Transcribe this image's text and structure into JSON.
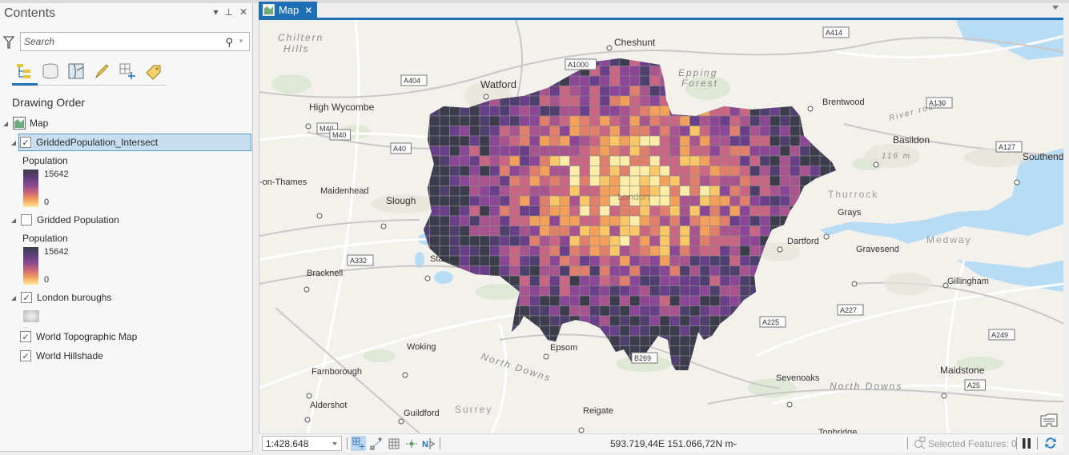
{
  "contents_pane": {
    "title": "Contents",
    "controls": {
      "menu": "▾",
      "pin": "⊥",
      "close": "✕"
    },
    "search": {
      "placeholder": "Search",
      "value": ""
    },
    "view_tabs": [
      "list-by-drawing-order",
      "list-by-source",
      "list-by-selection",
      "list-by-editing",
      "list-by-snapping",
      "list-by-labeling"
    ],
    "section_title": "Drawing Order",
    "map_item": {
      "label": "Map"
    },
    "layers": [
      {
        "label": "GriddedPopulation_Intersect",
        "checked": true,
        "selected": true,
        "legend": {
          "field": "Population",
          "max": "15642",
          "min": "0"
        }
      },
      {
        "label": "Gridded Population",
        "checked": false,
        "selected": false,
        "legend": {
          "field": "Population",
          "max": "15642",
          "min": "0"
        }
      },
      {
        "label": "London buroughs",
        "checked": true,
        "selected": false
      },
      {
        "label": "World Topographic Map",
        "checked": true,
        "selected": false
      },
      {
        "label": "World Hillshade",
        "checked": true,
        "selected": false
      }
    ]
  },
  "map_tab": {
    "label": "Map",
    "close": "✕"
  },
  "map": {
    "places": {
      "watford": "Watford",
      "cheshunt": "Cheshunt",
      "high_wycombe": "High Wycombe",
      "brentwood": "Brentwood",
      "basildon": "Basildon",
      "southend": "Southend",
      "slough": "Slough",
      "maidenhead": "Maidenhead",
      "on_thames": "-on-Thames",
      "grays": "Grays",
      "dartford": "Dartford",
      "gravesend": "Gravesend",
      "staines": "Staines",
      "bracknell": "Bracknell",
      "gillingham": "Gillingham",
      "epsom": "Epsom",
      "woking": "Woking",
      "farnborough": "Farnborough",
      "aldershot": "Aldershot",
      "guildford": "Guildford",
      "reigate": "Reigate",
      "sevenoaks": "Sevenoaks",
      "maidstone": "Maidstone",
      "tonbridge": "Tonbridge",
      "london": "London"
    },
    "natural": {
      "chiltern": "Chiltern",
      "hills": "Hills",
      "epping": "Epping",
      "forest": "Forest",
      "north_downs_w": "North Downs",
      "north_downs_e": "North Downs",
      "river": "River   rouch",
      "height": "116 m"
    },
    "regions": {
      "thurrock": "Thurrock",
      "medway": "Medway",
      "surrey": "Surrey"
    },
    "roads": {
      "a404": "A404",
      "a1000": "A1000",
      "a414": "A414",
      "m40a": "M40",
      "m40b": "M40",
      "a40": "A40",
      "a130": "A130",
      "a127": "A127",
      "a332": "A332",
      "a225": "A225",
      "a227": "A227",
      "a249": "A249",
      "b269": "B269",
      "a25": "A25"
    },
    "population_ramp": [
      "#3d3c4d",
      "#4e3f6e",
      "#6a3f8a",
      "#8b4796",
      "#a8548f",
      "#c86683",
      "#e07f6b",
      "#f2a05a",
      "#fbc868",
      "#fdeda8"
    ]
  },
  "statusbar": {
    "scale": "1:428.648",
    "coordinates": "593.719,44E 151.066,72N m",
    "selected_features": "Selected Features: 0"
  }
}
